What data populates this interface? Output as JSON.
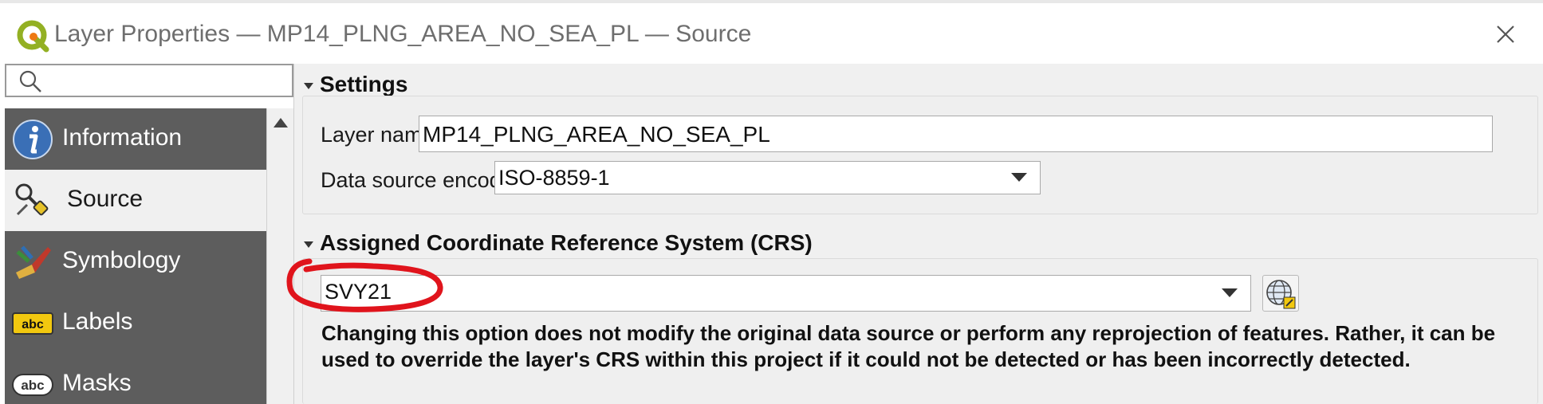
{
  "window": {
    "title": "Layer Properties — MP14_PLNG_AREA_NO_SEA_PL — Source",
    "logo_icon": "qgis-logo-icon",
    "close_icon": "close-icon"
  },
  "search": {
    "value": "",
    "placeholder": "",
    "icon": "search-icon"
  },
  "sidebar": {
    "items": [
      {
        "label": "Information",
        "icon": "information-icon",
        "active": false
      },
      {
        "label": "Source",
        "icon": "source-tools-icon",
        "active": true
      },
      {
        "label": "Symbology",
        "icon": "symbology-brush-icon",
        "active": false
      },
      {
        "label": "Labels",
        "icon": "labels-abc-icon",
        "active": false
      },
      {
        "label": "Masks",
        "icon": "masks-abc-icon",
        "active": false
      }
    ]
  },
  "settings": {
    "heading": "Settings",
    "layer_name_label": "Layer name",
    "layer_name_value": "MP14_PLNG_AREA_NO_SEA_PL",
    "encoding_label": "Data source encoding",
    "encoding_value": "ISO-8859-1"
  },
  "crs": {
    "heading": "Assigned Coordinate Reference System (CRS)",
    "selected": "SVY21",
    "select_button_icon": "crs-globe-icon",
    "note": "Changing this option does not modify the original data source or perform any reprojection of features. Rather, it can be used to override the layer's CRS within this project if it could not be detected or has been incorrectly detected."
  },
  "annotation": {
    "color": "#e0141c"
  },
  "colors": {
    "sidebar_bg": "#5d5d5d",
    "panel_bg": "#f0f0f0",
    "active_item_bg": "#f0f0f0"
  }
}
